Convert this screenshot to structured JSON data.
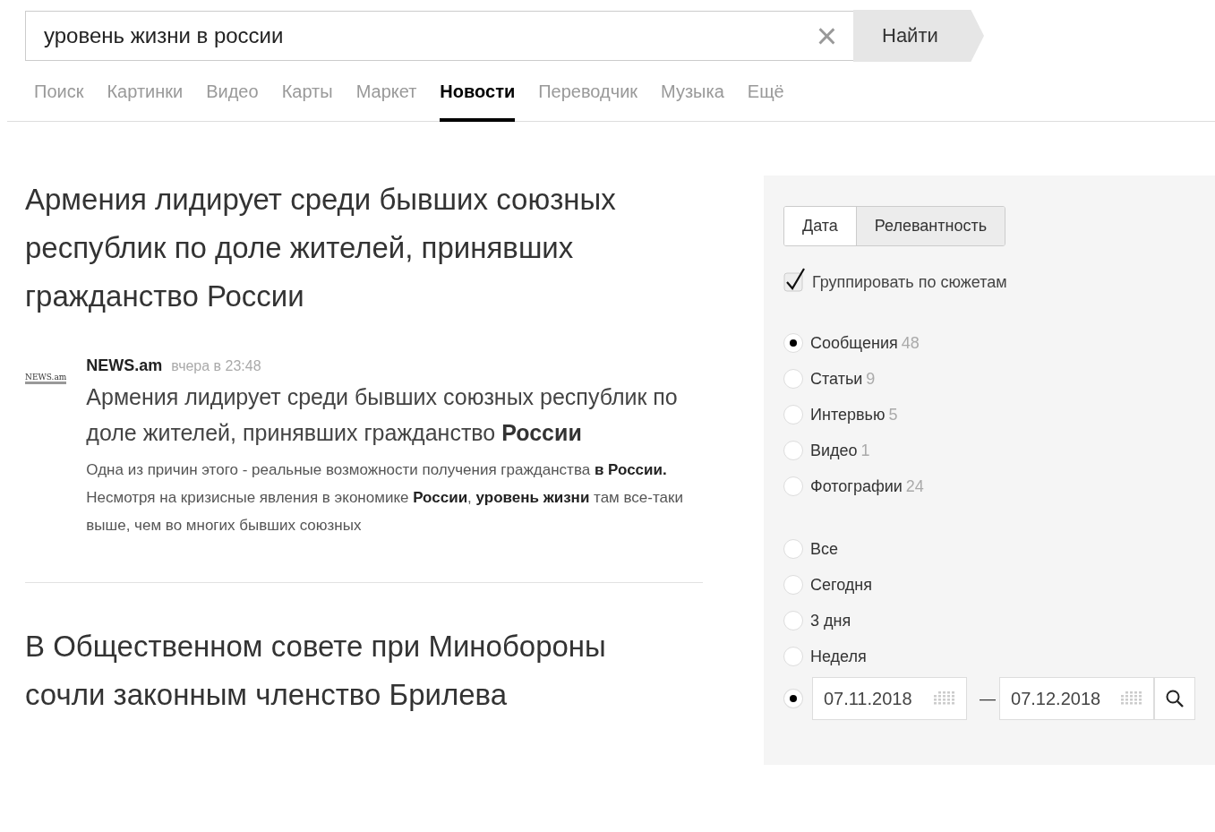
{
  "search": {
    "value": "уровень жизни в россии",
    "button": "Найти",
    "clear": "×"
  },
  "tabs": [
    {
      "label": "Поиск",
      "selected": false
    },
    {
      "label": "Картинки",
      "selected": false
    },
    {
      "label": "Видео",
      "selected": false
    },
    {
      "label": "Карты",
      "selected": false
    },
    {
      "label": "Маркет",
      "selected": false
    },
    {
      "label": "Новости",
      "selected": true
    },
    {
      "label": "Переводчик",
      "selected": false
    },
    {
      "label": "Музыка",
      "selected": false
    },
    {
      "label": "Ещё",
      "selected": false
    }
  ],
  "stories": [
    {
      "title": "Армения лидирует среди бывших союзных республик по доле жителей, принявших гражданство России",
      "item": {
        "logo": "NEWS.am",
        "source": "NEWS.am",
        "time": "вчера в 23:48",
        "headline": "Армения лидирует среди бывших союзных республик по доле жителей, принявших гражданство **России**",
        "snippet": "Одна из причин этого - реальные возможности получения гражданства **в России.** Несмотря на кризисные явления в экономике **России**, **уровень жизни** там все-таки выше, чем во многих бывших союзных"
      }
    },
    {
      "title": "В Общественном совете при Минобороны сочли законным членство Брилева"
    }
  ],
  "filters": {
    "sort": [
      {
        "label": "Дата",
        "selected": false
      },
      {
        "label": "Релевантность",
        "selected": true
      }
    ],
    "group": {
      "label": "Группировать по сюжетам",
      "checked": true
    },
    "types": [
      {
        "label": "Сообщения",
        "count": "48",
        "selected": true
      },
      {
        "label": "Статьи",
        "count": "9",
        "selected": false
      },
      {
        "label": "Интервью",
        "count": "5",
        "selected": false
      },
      {
        "label": "Видео",
        "count": "1",
        "selected": false
      },
      {
        "label": "Фотографии",
        "count": "24",
        "selected": false
      }
    ],
    "periods": [
      {
        "kind": "option",
        "label": "Все",
        "selected": false
      },
      {
        "kind": "option",
        "label": "Сегодня",
        "selected": false
      },
      {
        "kind": "option",
        "label": "3 дня",
        "selected": false
      },
      {
        "kind": "option",
        "label": "Неделя",
        "selected": false
      },
      {
        "kind": "range",
        "from": "07.11.2018",
        "dash": "—",
        "to": "07.12.2018",
        "selected": true
      }
    ]
  }
}
